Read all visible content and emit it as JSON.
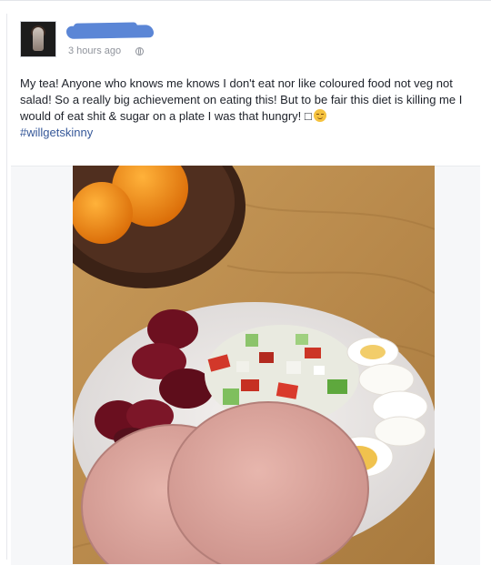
{
  "post": {
    "timestamp": "3 hours ago",
    "text": "My tea! Anyone who knows me knows I don't eat nor like coloured food not veg not salad! So a really big achievement on eating this! But to be fair this diet is killing me I would of eat shit & sugar on a plate I was that hungry! □",
    "hashtag": "#willgetskinny",
    "icons": {
      "privacy": "globe-icon",
      "emoji": "relieved-face-emoji-icon"
    }
  },
  "colors": {
    "text": "#1d2129",
    "meta": "#90949c",
    "link": "#365899",
    "redaction": "#5b86d6"
  }
}
